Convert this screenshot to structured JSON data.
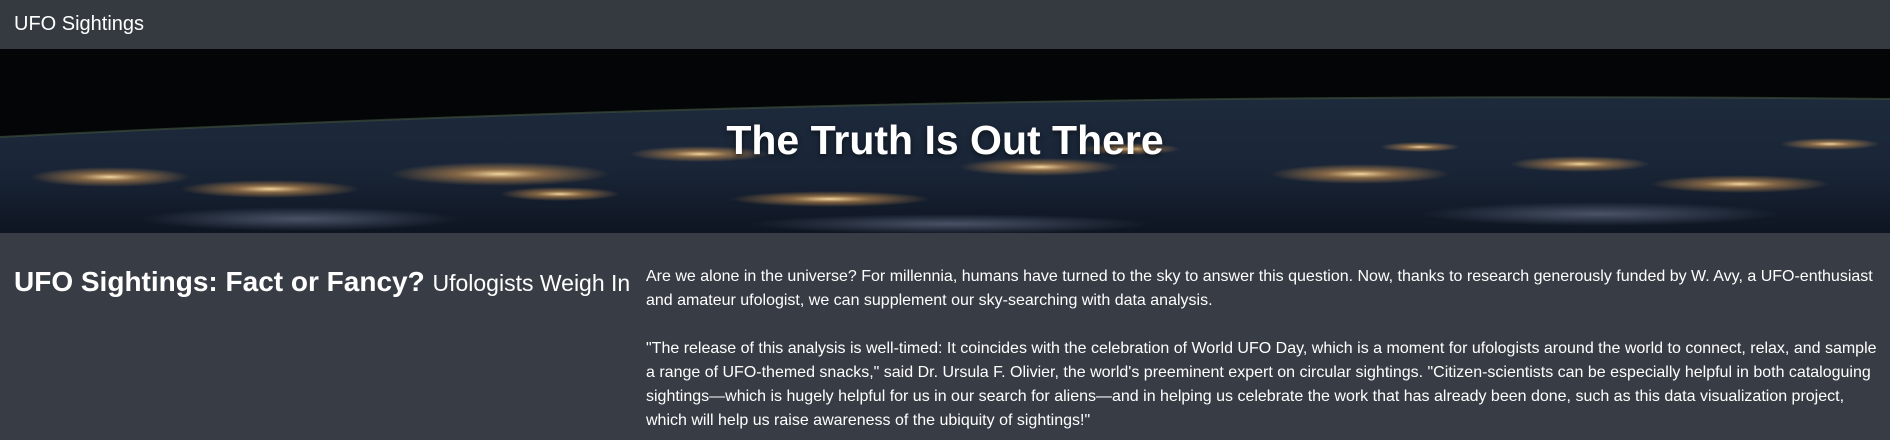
{
  "navbar": {
    "brand": "UFO Sightings"
  },
  "hero": {
    "title": "The Truth Is Out There"
  },
  "article": {
    "heading": "UFO Sightings: Fact or Fancy?",
    "subheading": "Ufologists Weigh In",
    "paragraphs": [
      "Are we alone in the universe? For millennia, humans have turned to the sky to answer this question. Now, thanks to research generously funded by W. Avy, a UFO-enthusiast and amateur ufologist, we can supplement our sky-searching with data analysis.",
      "\"The release of this analysis is well-timed: It coincides with the celebration of World UFO Day, which is a moment for ufologists around the world to connect, relax, and sample a range of UFO-themed snacks,\" said Dr. Ursula F. Olivier, the world's preeminent expert on circular sightings. \"Citizen-scientists can be especially helpful in both cataloguing sightings—which is hugely helpful for us in our search for aliens—and in helping us celebrate the work that has already been done, such as this data visualization project, which will help us raise awareness of the ubiquity of sightings!\""
    ]
  },
  "colors": {
    "page_background": "#383d45",
    "navbar_background": "#343a40",
    "text": "#ffffff"
  }
}
